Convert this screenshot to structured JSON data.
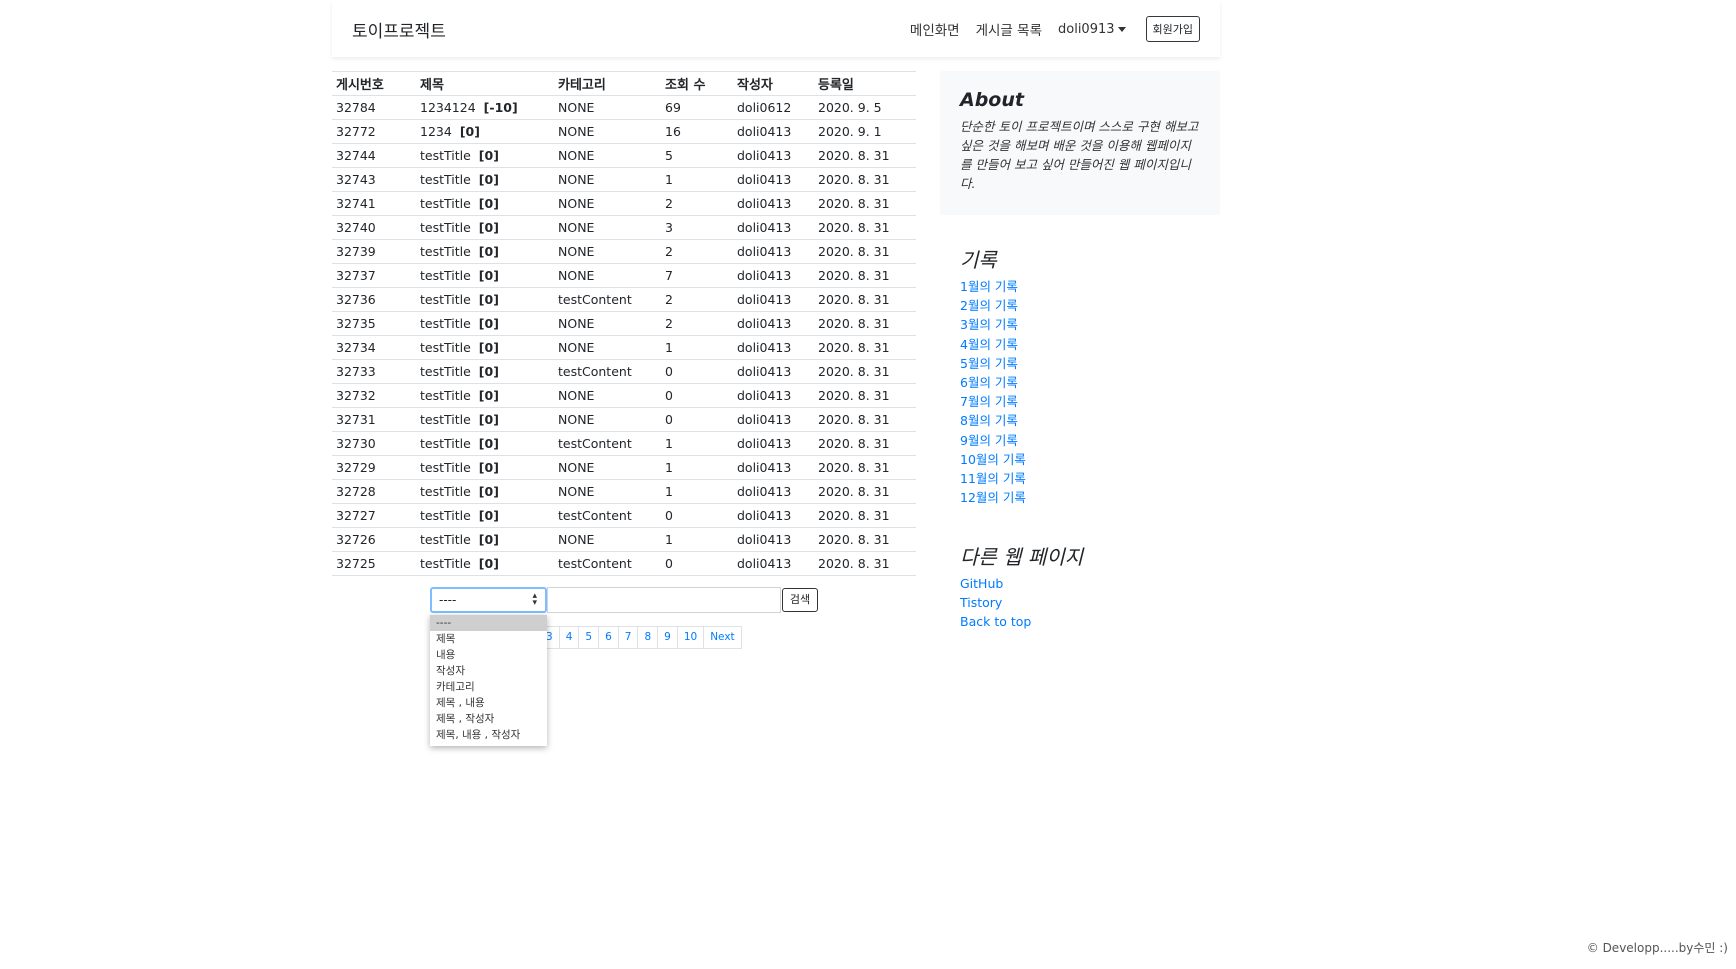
{
  "navbar": {
    "brand": "토이프로젝트",
    "links": [
      "메인화면",
      "게시글 목록"
    ],
    "user": "doli0913",
    "signup": "회원가입"
  },
  "table": {
    "headers": [
      "게시번호",
      "제목",
      "카테고리",
      "조회 수",
      "작성자",
      "등록일"
    ],
    "rows": [
      [
        "32784",
        "1234124",
        "[-10]",
        "NONE",
        "69",
        "doli0612",
        "2020. 9. 5"
      ],
      [
        "32772",
        "1234",
        "[0]",
        "NONE",
        "16",
        "doli0413",
        "2020. 9. 1"
      ],
      [
        "32744",
        "testTitle",
        "[0]",
        "NONE",
        "5",
        "doli0413",
        "2020. 8. 31"
      ],
      [
        "32743",
        "testTitle",
        "[0]",
        "NONE",
        "1",
        "doli0413",
        "2020. 8. 31"
      ],
      [
        "32741",
        "testTitle",
        "[0]",
        "NONE",
        "2",
        "doli0413",
        "2020. 8. 31"
      ],
      [
        "32740",
        "testTitle",
        "[0]",
        "NONE",
        "3",
        "doli0413",
        "2020. 8. 31"
      ],
      [
        "32739",
        "testTitle",
        "[0]",
        "NONE",
        "2",
        "doli0413",
        "2020. 8. 31"
      ],
      [
        "32737",
        "testTitle",
        "[0]",
        "NONE",
        "7",
        "doli0413",
        "2020. 8. 31"
      ],
      [
        "32736",
        "testTitle",
        "[0]",
        "testContent",
        "2",
        "doli0413",
        "2020. 8. 31"
      ],
      [
        "32735",
        "testTitle",
        "[0]",
        "NONE",
        "2",
        "doli0413",
        "2020. 8. 31"
      ],
      [
        "32734",
        "testTitle",
        "[0]",
        "NONE",
        "1",
        "doli0413",
        "2020. 8. 31"
      ],
      [
        "32733",
        "testTitle",
        "[0]",
        "testContent",
        "0",
        "doli0413",
        "2020. 8. 31"
      ],
      [
        "32732",
        "testTitle",
        "[0]",
        "NONE",
        "0",
        "doli0413",
        "2020. 8. 31"
      ],
      [
        "32731",
        "testTitle",
        "[0]",
        "NONE",
        "0",
        "doli0413",
        "2020. 8. 31"
      ],
      [
        "32730",
        "testTitle",
        "[0]",
        "testContent",
        "1",
        "doli0413",
        "2020. 8. 31"
      ],
      [
        "32729",
        "testTitle",
        "[0]",
        "NONE",
        "1",
        "doli0413",
        "2020. 8. 31"
      ],
      [
        "32728",
        "testTitle",
        "[0]",
        "NONE",
        "1",
        "doli0413",
        "2020. 8. 31"
      ],
      [
        "32727",
        "testTitle",
        "[0]",
        "testContent",
        "0",
        "doli0413",
        "2020. 8. 31"
      ],
      [
        "32726",
        "testTitle",
        "[0]",
        "NONE",
        "1",
        "doli0413",
        "2020. 8. 31"
      ],
      [
        "32725",
        "testTitle",
        "[0]",
        "testContent",
        "0",
        "doli0413",
        "2020. 8. 31"
      ]
    ]
  },
  "search": {
    "selected": "----",
    "options": [
      "----",
      "제목",
      "내용",
      "작성자",
      "카테고리",
      "제목 , 내용",
      "제목 , 작성자",
      "제목, 내용 , 작성자"
    ],
    "button": "검색"
  },
  "pagination": [
    "3",
    "4",
    "5",
    "6",
    "7",
    "8",
    "9",
    "10",
    "Next"
  ],
  "about": {
    "title": "About",
    "text": "단순한 토이 프로젝트이며 스스로 구현 해보고 싶은 것을 해보며 배운 것을 이용해 웹페이지를 만들어 보고 싶어 만들어진 웹 페이지입니다."
  },
  "archive": {
    "title": "기록",
    "items": [
      "1월의 기록",
      "2월의 기록",
      "3월의 기록",
      "4월의 기록",
      "5월의 기록",
      "6월의 기록",
      "7월의 기록",
      "8월의 기록",
      "9월의 기록",
      "10월의 기록",
      "11월의 기록",
      "12월의 기록"
    ]
  },
  "other_pages": {
    "title": "다른 웹 페이지",
    "items": [
      "GitHub",
      "Tistory",
      "Back to top"
    ]
  },
  "footer": "© Developp.....by수민 :)",
  "colors": {
    "link": "#007bff",
    "focus_border": "#80bdff"
  }
}
